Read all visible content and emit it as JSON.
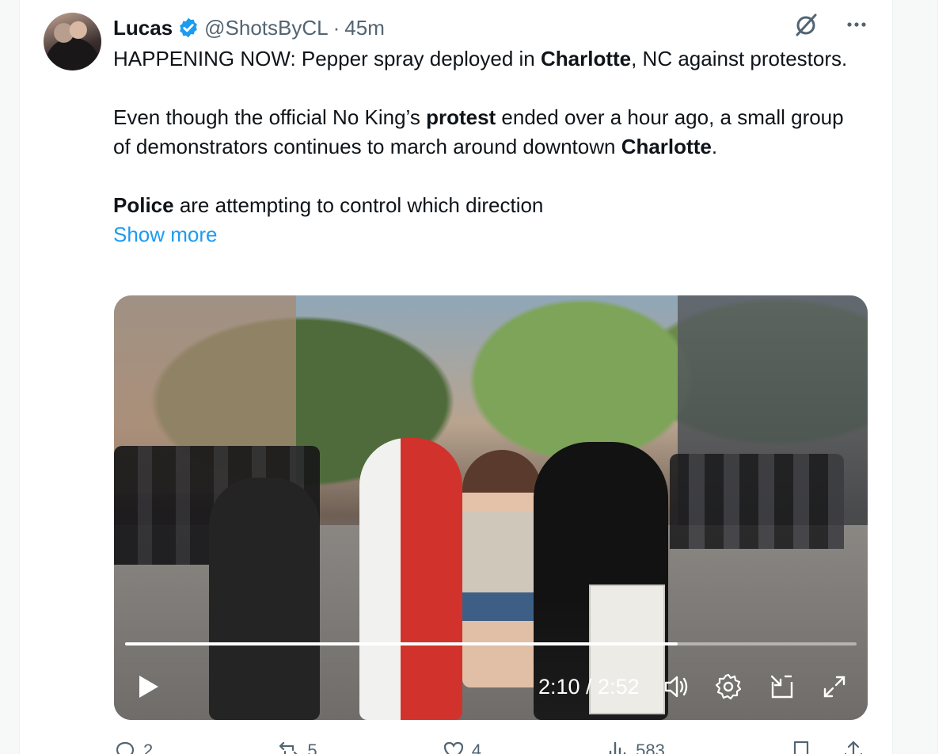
{
  "tweet": {
    "author_name": "Lucas",
    "handle": "@ShotsByCL",
    "separator": "·",
    "time": "45m",
    "paragraphs": [
      [
        {
          "text": "HAPPENING NOW: Pepper spray deployed in ",
          "bold": false
        },
        {
          "text": "Charlotte",
          "bold": true
        },
        {
          "text": ", NC against protestors.",
          "bold": false
        }
      ],
      [
        {
          "text": "Even though the official No King’s ",
          "bold": false
        },
        {
          "text": "protest",
          "bold": true
        },
        {
          "text": " ended over a hour ago, a small group of demonstrators continues to march around downtown ",
          "bold": false
        },
        {
          "text": "Charlotte",
          "bold": true
        },
        {
          "text": ".",
          "bold": false
        }
      ],
      [
        {
          "text": "Police",
          "bold": true
        },
        {
          "text": " are attempting to control which direction",
          "bold": false
        }
      ]
    ],
    "show_more": "Show more"
  },
  "video": {
    "timecode": "2:10 / 2:52",
    "progress": 0.755,
    "icons": [
      "play-icon",
      "volume-icon",
      "settings-icon",
      "pip-icon",
      "fullscreen-icon"
    ]
  },
  "actions": {
    "replies": "2",
    "reposts": "5",
    "likes": "4",
    "views": "583"
  },
  "colors": {
    "link": "#1d9bf0",
    "verified": "#1d9bf0",
    "muted": "#536471"
  }
}
